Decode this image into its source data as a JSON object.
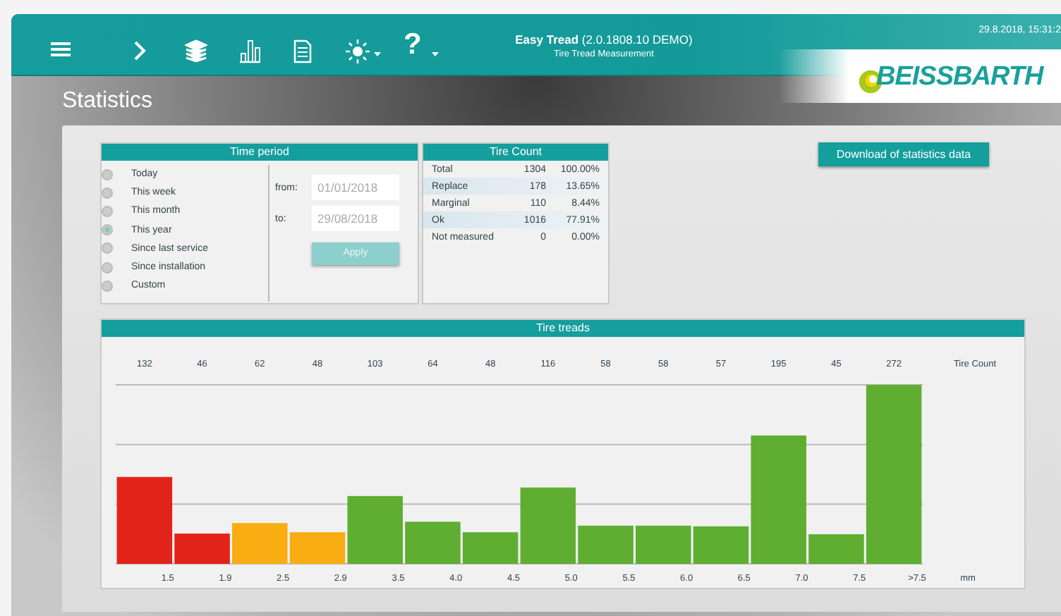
{
  "header": {
    "title": "Easy Tread",
    "version": "(2.0.1808.10 DEMO)",
    "subtitle": "Tire Tread Measurement",
    "datetime": "29.8.2018, 15:31:2",
    "help": "?",
    "logo": "BEISSBARTH"
  },
  "page_title": "Statistics",
  "time_period": {
    "title": "Time period",
    "options": [
      {
        "label": "Today",
        "selected": false
      },
      {
        "label": "This week",
        "selected": false
      },
      {
        "label": "This month",
        "selected": false
      },
      {
        "label": "This year",
        "selected": true
      },
      {
        "label": "Since last service",
        "selected": false
      },
      {
        "label": "Since installation",
        "selected": false
      },
      {
        "label": "Custom",
        "selected": false
      }
    ],
    "from_label": "from:",
    "from_value": "01/01/2018",
    "to_label": "to:",
    "to_value": "29/08/2018",
    "apply": {
      "label": "Apply",
      "disabled": true
    }
  },
  "tire_count": {
    "title": "Tire Count",
    "rows": [
      {
        "label": "Total",
        "count": "1304",
        "percent": "100.00%"
      },
      {
        "label": "Replace",
        "count": "178",
        "percent": "13.65%"
      },
      {
        "label": "Marginal",
        "count": "110",
        "percent": "8.44%"
      },
      {
        "label": "Ok",
        "count": "1016",
        "percent": "77.91%"
      },
      {
        "label": "Not measured",
        "count": "0",
        "percent": "0.00%"
      }
    ]
  },
  "download_button": "Download of statistics data",
  "tire_treads": {
    "title": "Tire treads",
    "count_heading": "Tire Count",
    "unit": "mm",
    "bins": [
      {
        "count": "132",
        "label": "1.5",
        "color": "#e2231a"
      },
      {
        "count": "46",
        "label": "1.9",
        "color": "#e2231a"
      },
      {
        "count": "62",
        "label": "2.5",
        "color": "#f8ae12"
      },
      {
        "count": "48",
        "label": "2.9",
        "color": "#f8ae12"
      },
      {
        "count": "103",
        "label": "3.5",
        "color": "#5fae32"
      },
      {
        "count": "64",
        "label": "4.0",
        "color": "#5fae32"
      },
      {
        "count": "48",
        "label": "4.5",
        "color": "#5fae32"
      },
      {
        "count": "116",
        "label": "5.0",
        "color": "#5fae32"
      },
      {
        "count": "58",
        "label": "5.5",
        "color": "#5fae32"
      },
      {
        "count": "58",
        "label": "6.0",
        "color": "#5fae32"
      },
      {
        "count": "57",
        "label": "6.5",
        "color": "#5fae32"
      },
      {
        "count": "195",
        "label": "7.0",
        "color": "#5fae32"
      },
      {
        "count": "45",
        "label": "7.5",
        "color": "#5fae32"
      },
      {
        "count": "272",
        "label": ">7.5",
        "color": "#5fae32"
      }
    ]
  }
}
